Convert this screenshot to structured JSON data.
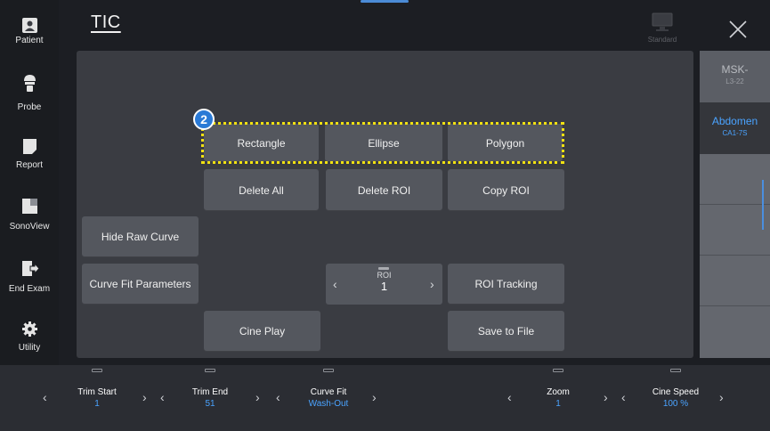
{
  "sidebar": {
    "items": [
      {
        "label": "Patient",
        "icon": "patient-icon"
      },
      {
        "label": "Probe",
        "icon": "probe-icon"
      },
      {
        "label": "Report",
        "icon": "report-icon"
      },
      {
        "label": "SonoView",
        "icon": "sonoview-icon"
      },
      {
        "label": "End Exam",
        "icon": "end-exam-icon"
      },
      {
        "label": "Utility",
        "icon": "utility-icon"
      }
    ]
  },
  "header": {
    "title": "TIC",
    "preset_label": "Standard",
    "close_icon": "close-icon"
  },
  "main": {
    "step_number": "2",
    "buttons": {
      "rectangle": "Rectangle",
      "ellipse": "Ellipse",
      "polygon": "Polygon",
      "delete_all": "Delete All",
      "delete_roi": "Delete ROI",
      "copy_roi": "Copy ROI",
      "hide_raw_curve": "Hide Raw Curve",
      "curve_fit_parameters": "Curve Fit Parameters",
      "roi_tracking": "ROI Tracking",
      "cine_play": "Cine Play",
      "save_to_file": "Save to File"
    },
    "roi_stepper": {
      "label": "ROI",
      "value": "1"
    }
  },
  "probes": [
    {
      "name": "MSK-",
      "sub": "L3-22",
      "active": false
    },
    {
      "name": "Abdomen",
      "sub": "CA1-7S",
      "active": true
    }
  ],
  "bottom_controls": [
    {
      "name": "Trim Start",
      "value": "1"
    },
    {
      "name": "Trim End",
      "value": "51"
    },
    {
      "name": "Curve Fit",
      "value": "Wash-Out"
    },
    {
      "name": "Zoom",
      "value": "1"
    },
    {
      "name": "Cine Speed",
      "value": "100 %"
    }
  ],
  "colors": {
    "highlight": "#f1e112",
    "accent": "#4aa3ff",
    "active_tab": "#2f5fa8",
    "step_badge": "#2a7ad6"
  }
}
